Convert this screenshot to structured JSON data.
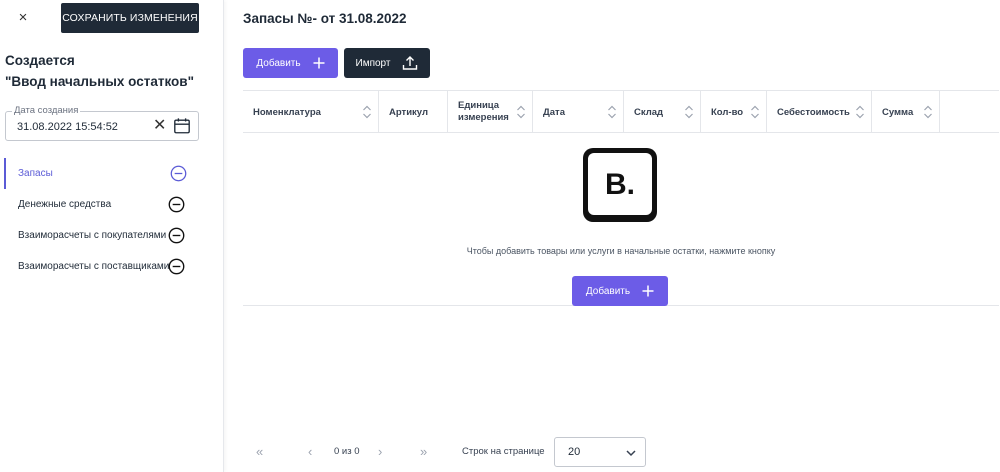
{
  "header": {
    "close_glyph": "×",
    "save_label": "СОХРАНИТЬ ИЗМЕНЕНИЯ"
  },
  "document": {
    "status": "Создается",
    "type": "\"Ввод начальных остатков\"",
    "date_label": "Дата создания",
    "date_value": "31.08.2022 15:54:52",
    "clear_glyph": "✕"
  },
  "sidebar": {
    "items": [
      {
        "label": "Запасы",
        "active": true
      },
      {
        "label": "Денежные средства",
        "active": false
      },
      {
        "label": "Взаиморасчеты с покупателями",
        "active": false
      },
      {
        "label": "Взаиморасчеты с поставщиками",
        "active": false
      }
    ]
  },
  "main": {
    "title": "Запасы №- от 31.08.2022",
    "add_label": "Добавить",
    "import_label": "Импорт",
    "columns": [
      {
        "line1": "Номенклатура",
        "line2": ""
      },
      {
        "line1": "Артикул",
        "line2": ""
      },
      {
        "line1": "Единица",
        "line2": "измерения"
      },
      {
        "line1": "Дата",
        "line2": ""
      },
      {
        "line1": "Склад",
        "line2": ""
      },
      {
        "line1": "Кол-во",
        "line2": ""
      },
      {
        "line1": "Себестоимость",
        "line2": ""
      },
      {
        "line1": "Сумма",
        "line2": ""
      }
    ],
    "empty_logo_text": "B.",
    "empty_text": "Чтобы добавить товары или услуги в начальные остатки, нажмите кнопку",
    "empty_add_label": "Добавить"
  },
  "pagination": {
    "first_glyph": "«",
    "prev_glyph": "‹",
    "info": "0 из 0",
    "next_glyph": "›",
    "last_glyph": "»",
    "rows_label": "Строк на странице",
    "rows_value": "20"
  },
  "colors": {
    "accent": "#6c5ce7",
    "dark": "#1f2a37"
  }
}
